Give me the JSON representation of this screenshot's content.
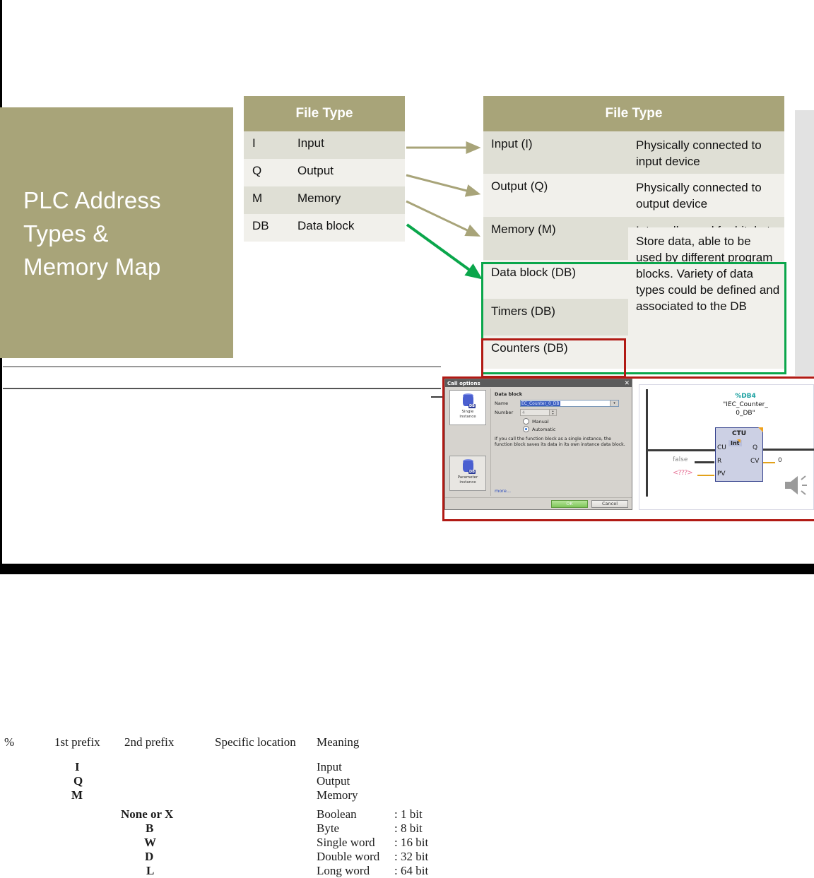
{
  "slide": {
    "title_lines": [
      "PLC Address",
      "Types &",
      "Memory Map"
    ]
  },
  "file_type_table": {
    "header": "File Type",
    "rows": [
      {
        "code": "I",
        "name": "Input"
      },
      {
        "code": "Q",
        "name": "Output"
      },
      {
        "code": "M",
        "name": "Memory"
      },
      {
        "code": "DB",
        "name": "Data block"
      }
    ]
  },
  "detail_table": {
    "header": "File Type",
    "rows": [
      {
        "type": "Input (I)",
        "desc": "Physically connected to input device"
      },
      {
        "type": "Output (Q)",
        "desc": "Physically connected to output device"
      },
      {
        "type": "Memory (M)",
        "desc": "Internally used for bit, byte or data operation"
      },
      {
        "type": "Data block (DB)",
        "desc": ""
      },
      {
        "type": "Timers (DB)",
        "desc": ""
      },
      {
        "type": "Counters (DB)",
        "desc": ""
      }
    ],
    "merged_desc": "Store data, able to be used by different program blocks. Variety of data types could be defined and associated to the DB",
    "highlight_green": "#0aa64b",
    "highlight_red": "#b11a14",
    "header_color": "#a8a479"
  },
  "reference_table": {
    "headers": [
      "%",
      "1st prefix",
      "2nd prefix",
      "Specific location",
      "Meaning"
    ],
    "first_prefix": [
      {
        "symbol": "I",
        "meaning": "Input"
      },
      {
        "symbol": "Q",
        "meaning": "Output"
      },
      {
        "symbol": "M",
        "meaning": "Memory"
      }
    ],
    "second_prefix": [
      {
        "symbol": "None or X",
        "meaning": "Boolean",
        "size": ": 1 bit"
      },
      {
        "symbol": "B",
        "meaning": "Byte",
        "size": ": 8 bit"
      },
      {
        "symbol": "W",
        "meaning": "Single word",
        "size": ": 16 bit"
      },
      {
        "symbol": "D",
        "meaning": "Double word",
        "size": ": 32 bit"
      },
      {
        "symbol": "L",
        "meaning": "Long word",
        "size": ": 64 bit"
      }
    ]
  },
  "call_options_dialog": {
    "title": "Call options",
    "close_glyph": "✕",
    "left_options": [
      {
        "label_line1": "Single",
        "label_line2": "instance",
        "badge": "DB"
      },
      {
        "label_line1": "Parameter",
        "label_line2": "instance",
        "badge": "DB"
      }
    ],
    "section_title": "Data block",
    "name_label": "Name",
    "name_value": "EC_Counter_0_DB",
    "number_label": "Number",
    "number_value": "4",
    "radio_manual": "Manual",
    "radio_automatic": "Automatic",
    "selected_radio": "Automatic",
    "help_text": "If you call the function block as a single instance, the function block saves its data in its own instance data block.",
    "more_link": "more...",
    "ok_label": "OK",
    "cancel_label": "Cancel"
  },
  "ctu_screenshot": {
    "db_number": "%DB4",
    "db_name_line1": "\"IEC_Counter_",
    "db_name_line2": "0_DB\"",
    "block_name": "CTU",
    "block_type": "Int",
    "inputs": [
      "CU",
      "R",
      "PV"
    ],
    "outputs": [
      "Q",
      "CV"
    ],
    "r_value": "false",
    "pv_value": "<???>",
    "cv_value": "0"
  }
}
